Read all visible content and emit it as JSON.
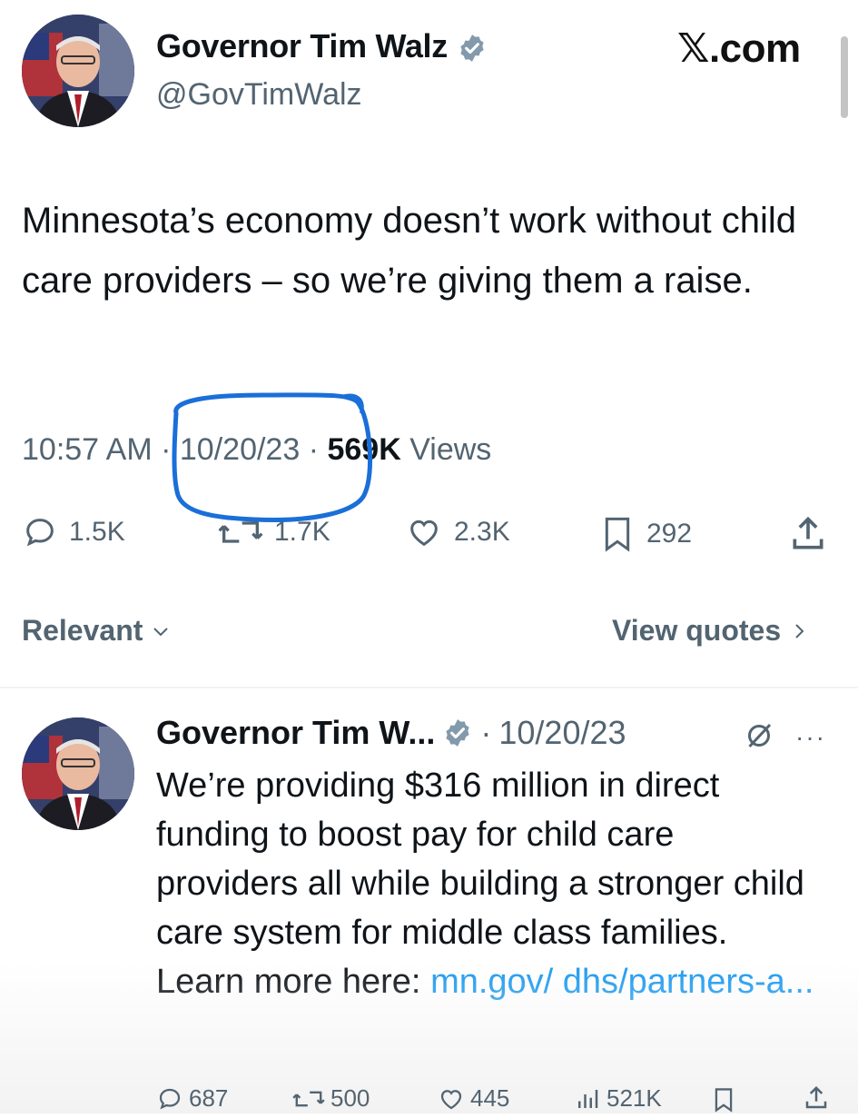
{
  "watermark": "𝕏.com",
  "tweet": {
    "author_name": "Governor Tim Walz",
    "author_handle": "@GovTimWalz",
    "text": "Minnesota’s economy doesn’t work without child care providers – so we’re giving them a raise.",
    "time": "10:57 AM",
    "date": "10/20/23",
    "separator": "·",
    "views_count": "569K",
    "views_label": "Views",
    "actions": {
      "replies": "1.5K",
      "reposts": "1.7K",
      "likes": "2.3K",
      "bookmarks": "292"
    }
  },
  "sort_bar": {
    "sort_label": "Relevant",
    "quotes_label": "View quotes"
  },
  "reply": {
    "author_name": "Governor Tim W...",
    "separator": "·",
    "date": "10/20/23",
    "text": "We’re providing $316 million in direct funding to boost pay for child care providers all while building a stronger child care system for middle class families. Learn more here: ",
    "link": "mn.gov/ dhs/partners-a...",
    "actions": {
      "replies": "687",
      "reposts": "500",
      "likes": "445",
      "views": "521K"
    }
  },
  "colors": {
    "text": "#0f1419",
    "secondary": "#536471",
    "link": "#1d9bf0",
    "annotation": "#1a6fd8"
  }
}
